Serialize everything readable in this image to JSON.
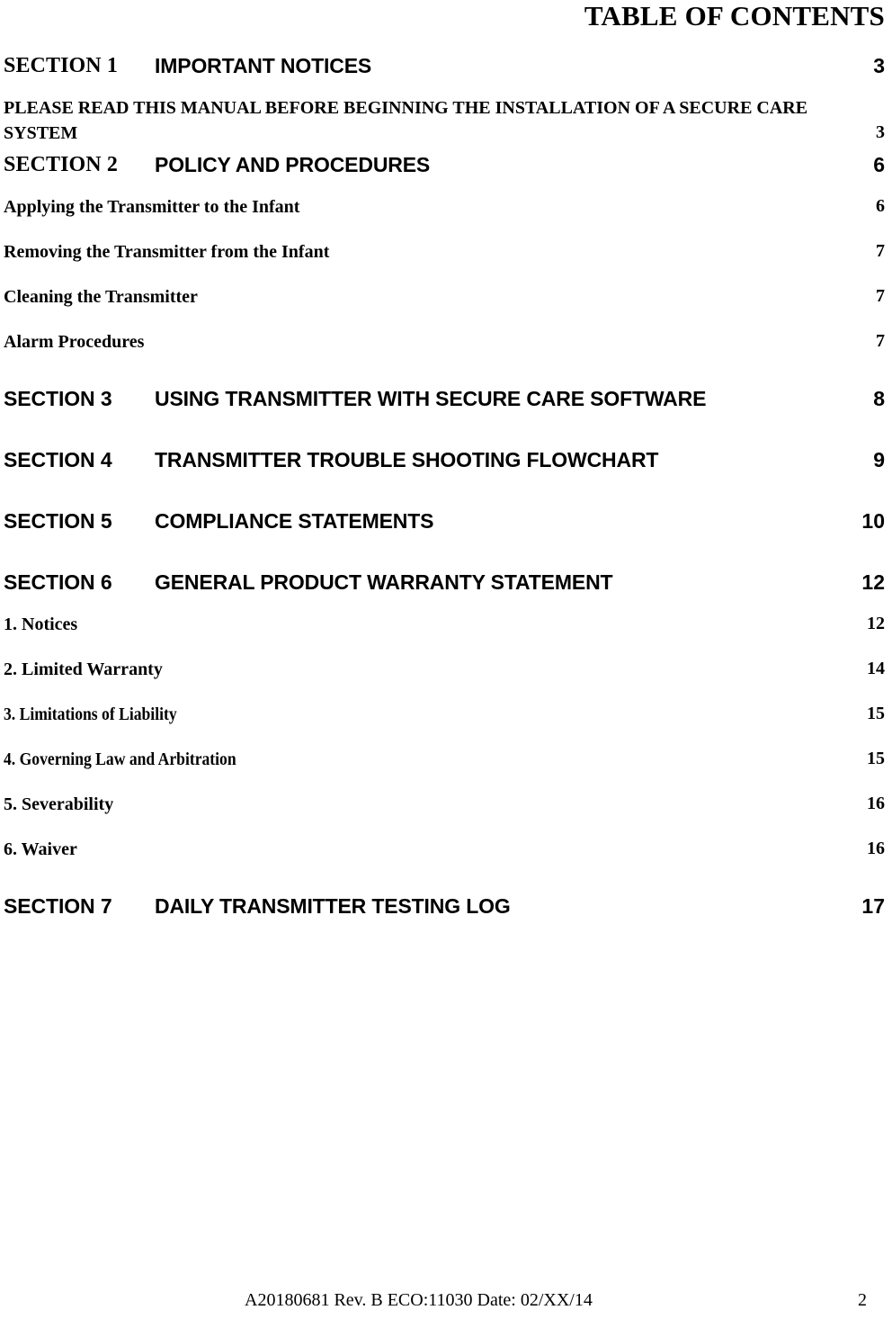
{
  "document": {
    "title": "TABLE OF CONTENTS"
  },
  "toc": {
    "entries": [
      {
        "level": 1,
        "label": "SECTION 1",
        "title": "IMPORTANT NOTICES",
        "page": "3",
        "label_style": "serif"
      },
      {
        "level": 2,
        "text": "PLEASE READ THIS MANUAL BEFORE BEGINNING THE INSTALLATION OF A SECURE CARE SYSTEM",
        "page": "3",
        "wrapped": true
      },
      {
        "level": 1,
        "label": "SECTION 2",
        "title": "POLICY AND PROCEDURES",
        "page": "6",
        "label_style": "serif"
      },
      {
        "level": 2,
        "text": "Applying the Transmitter to the Infant",
        "page": "6"
      },
      {
        "level": 2,
        "text": "Removing the Transmitter from the Infant",
        "page": "7"
      },
      {
        "level": 2,
        "text": "Cleaning the Transmitter",
        "page": "7"
      },
      {
        "level": 2,
        "text": "Alarm Procedures",
        "page": "7"
      },
      {
        "level": 1,
        "label": "SECTION 3",
        "title": "USING TRANSMITTER WITH SECURE CARE SOFTWARE",
        "page": "8",
        "label_style": "sans"
      },
      {
        "level": 1,
        "label": "SECTION 4",
        "title": "TRANSMITTER TROUBLE SHOOTING FLOWCHART",
        "page": "9",
        "label_style": "sans"
      },
      {
        "level": 1,
        "label": "SECTION 5",
        "title": "COMPLIANCE STATEMENTS",
        "page": "10",
        "label_style": "sans"
      },
      {
        "level": 1,
        "label": "SECTION 6",
        "title": "GENERAL PRODUCT WARRANTY STATEMENT",
        "page": "12",
        "label_style": "sans"
      },
      {
        "level": 2,
        "text": "1. Notices",
        "page": "12"
      },
      {
        "level": 2,
        "text": "2. Limited Warranty",
        "page": "14"
      },
      {
        "level": 2,
        "text": "3. Limitations of Liability",
        "page": "15",
        "condensed": true
      },
      {
        "level": 2,
        "text": "4. Governing Law and Arbitration",
        "page": "15",
        "condensed": true
      },
      {
        "level": 2,
        "text": "5. Severability",
        "page": "16"
      },
      {
        "level": 2,
        "text": "6. Waiver",
        "page": "16"
      },
      {
        "level": 1,
        "label": "SECTION 7",
        "title": "DAILY TRANSMITTER TESTING LOG",
        "page": "17",
        "label_style": "sans"
      }
    ]
  },
  "footer": {
    "text": "A20180681 Rev. B  ECO:11030 Date: 02/XX/14",
    "page_number": "2"
  }
}
